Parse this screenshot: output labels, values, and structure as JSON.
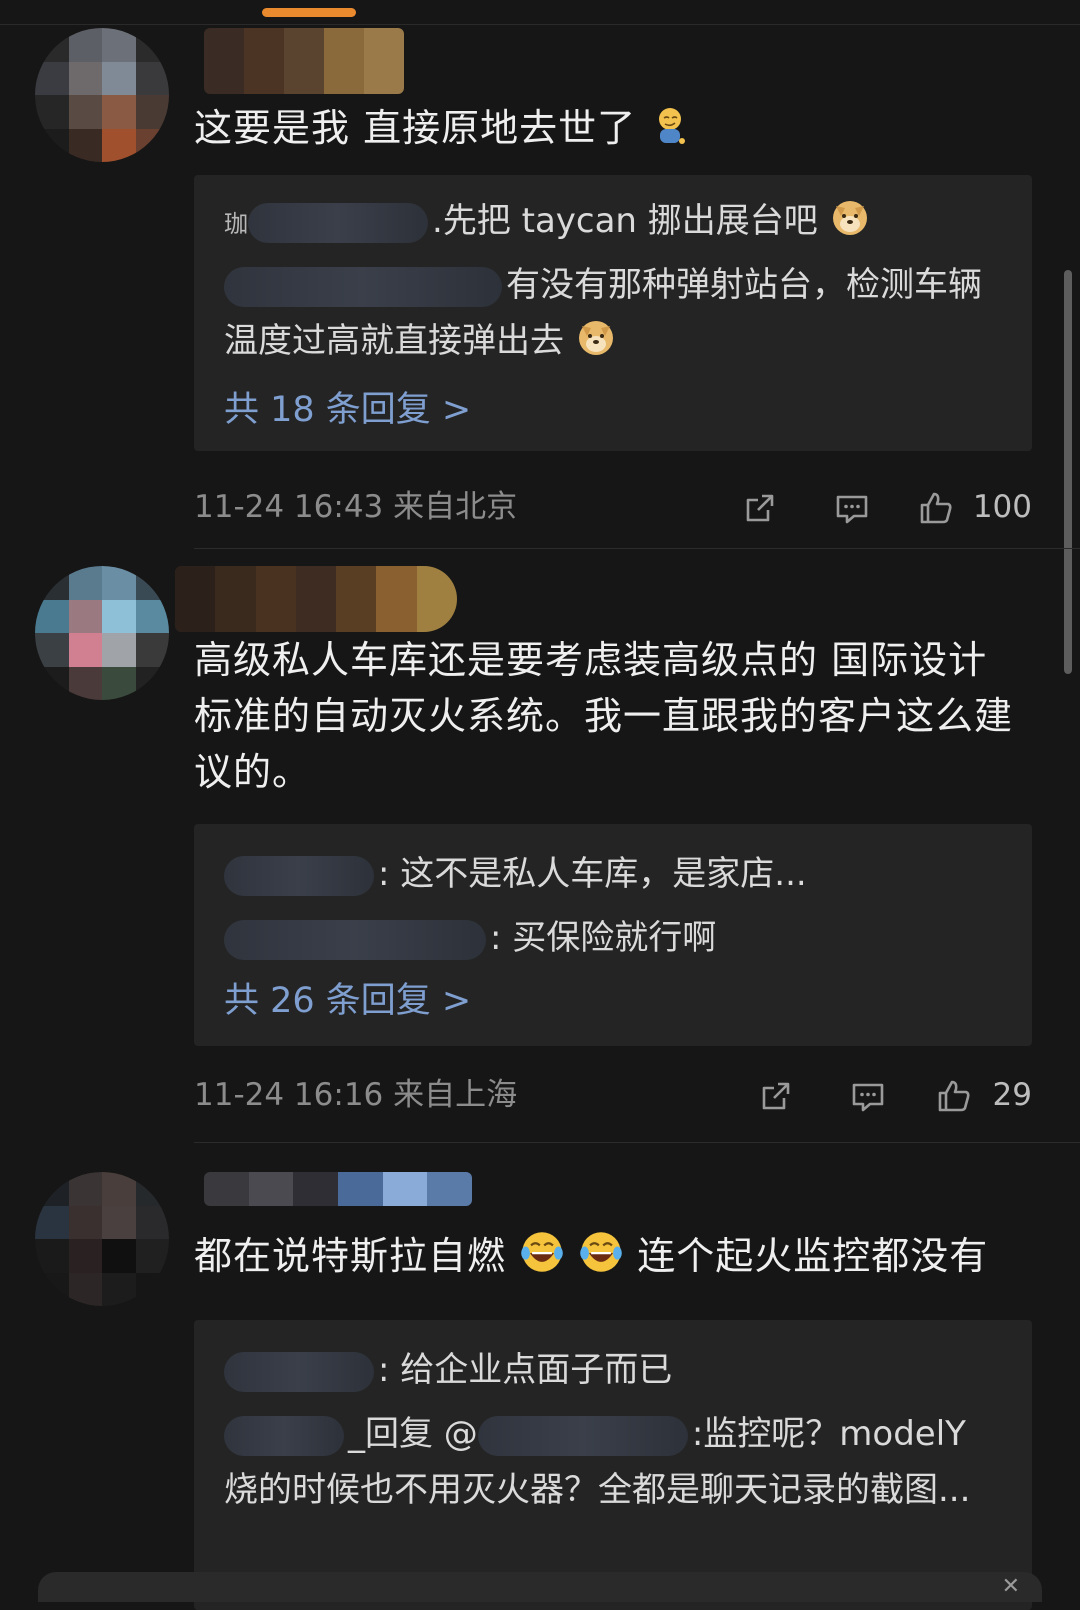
{
  "colors": {
    "background": "#161616",
    "reply_box": "#242424",
    "link": "#7f9fd0",
    "indicator": "#e98a2e",
    "meta": "#8c8c8c"
  },
  "comments": [
    {
      "text": "这要是我 直接原地去世了",
      "emoji": "smirk-emoji",
      "replies": [
        {
          "text": "先把 taycan 挪出展台吧",
          "emoji": "doge-emoji",
          "prefix": "珈",
          "sep": "."
        },
        {
          "text": "有没有那种弹射站台，检测车辆温度过高就直接弹出去",
          "emoji": "doge-emoji",
          "prefix": "",
          "sep": ""
        }
      ],
      "more": "共 18 条回复 >",
      "meta": "11-24 16:43 来自北京",
      "likes": "100"
    },
    {
      "text": "高级私人车库还是要考虑装高级点的 国际设计标准的自动灭火系统。我一直跟我的客户这么建议的。",
      "replies": [
        {
          "text": "这不是私人车库，是家店...",
          "prefix": "",
          "sep": ": "
        },
        {
          "text": "买保险就行啊",
          "prefix": "",
          "sep": ": "
        }
      ],
      "more": "共 26 条回复 >",
      "meta": "11-24 16:16 来自上海",
      "likes": "29"
    },
    {
      "text_parts": [
        "都在说特斯拉自燃",
        "连个起火监控都没有"
      ],
      "emoji": "laugh-cry-emoji",
      "replies": [
        {
          "text": "给企业点面子而已",
          "prefix": "",
          "sep": ": "
        },
        {
          "text": "_回复 @",
          "text2": ":监控呢？modelY 烧的时候也不用灭火器？全都是聊天记录的截图...",
          "prefix": "",
          "sep": ""
        }
      ]
    }
  ]
}
